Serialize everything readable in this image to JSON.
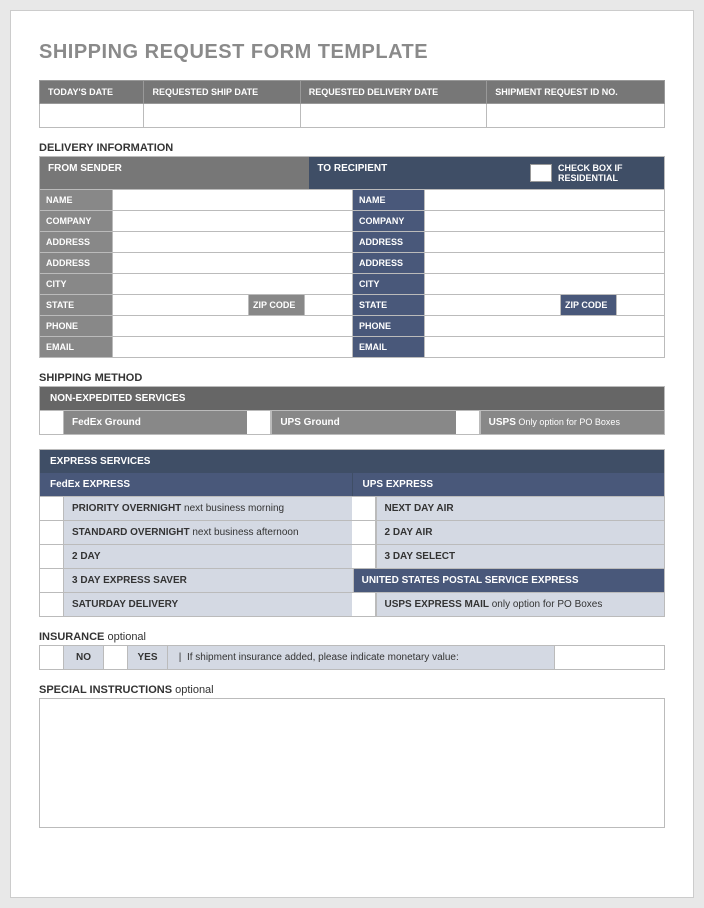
{
  "title": "SHIPPING REQUEST FORM TEMPLATE",
  "top_headers": [
    "TODAY'S DATE",
    "REQUESTED SHIP DATE",
    "REQUESTED DELIVERY DATE",
    "SHIPMENT REQUEST ID NO."
  ],
  "delivery": {
    "section": "DELIVERY INFORMATION",
    "from": "FROM SENDER",
    "to": "TO RECIPIENT",
    "residential": "CHECK BOX IF RESIDENTIAL",
    "fields": [
      "NAME",
      "COMPANY",
      "ADDRESS",
      "ADDRESS",
      "CITY",
      "STATE",
      "PHONE",
      "EMAIL"
    ],
    "zip": "ZIP CODE"
  },
  "shipping": {
    "section": "SHIPPING METHOD",
    "non_exp_hdr": "NON-EXPEDITED SERVICES",
    "opts": [
      {
        "name": "FedEx Ground",
        "note": ""
      },
      {
        "name": "UPS Ground",
        "note": ""
      },
      {
        "name": "USPS",
        "note": " Only option for PO Boxes"
      }
    ]
  },
  "express": {
    "hdr": "EXPRESS SERVICES",
    "left_hdr": "FedEx EXPRESS",
    "right_hdr": "UPS EXPRESS",
    "rows": [
      {
        "l_b": "PRIORITY OVERNIGHT",
        "l_n": " next business morning",
        "r_b": "NEXT DAY AIR",
        "r_n": ""
      },
      {
        "l_b": "STANDARD OVERNIGHT",
        "l_n": " next business afternoon",
        "r_b": "2 DAY AIR",
        "r_n": ""
      },
      {
        "l_b": "2 DAY",
        "l_n": "",
        "r_b": "3 DAY SELECT",
        "r_n": ""
      },
      {
        "l_b": "3 DAY EXPRESS SAVER",
        "l_n": "",
        "r_hdr": "UNITED STATES POSTAL SERVICE EXPRESS"
      },
      {
        "l_b": "SATURDAY DELIVERY",
        "l_n": "",
        "r_b": "USPS EXPRESS MAIL",
        "r_n": " only option for PO Boxes"
      }
    ]
  },
  "insurance": {
    "section": "INSURANCE",
    "opt": " optional",
    "no": "NO",
    "yes": "YES",
    "txt": "If shipment insurance added, please indicate monetary value:"
  },
  "instructions": {
    "section": "SPECIAL INSTRUCTIONS",
    "opt": " optional"
  }
}
